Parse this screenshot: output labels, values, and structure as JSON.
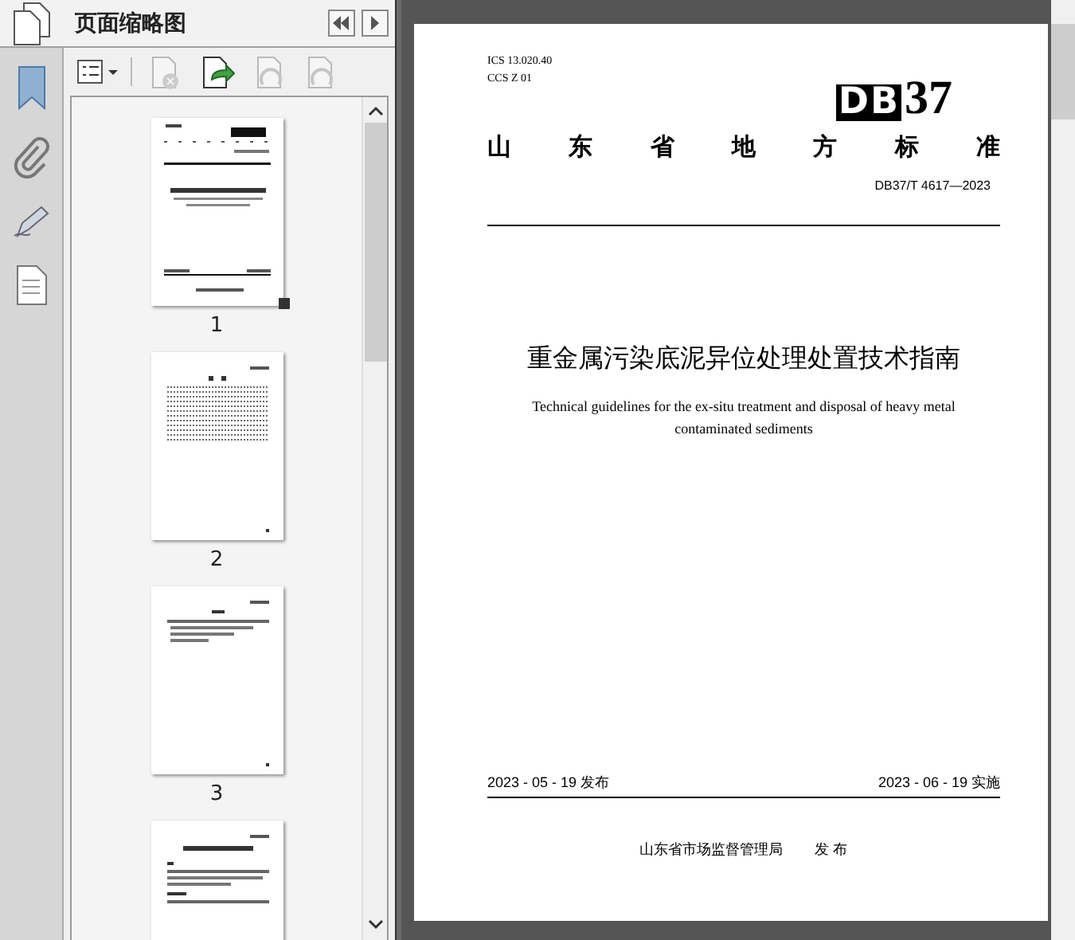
{
  "panel": {
    "title": "页面缩略图",
    "toolbar": [
      {
        "kind": "options",
        "disabled": false
      },
      {
        "kind": "delete",
        "disabled": true
      },
      {
        "kind": "insert",
        "disabled": false
      },
      {
        "kind": "rotate-left",
        "disabled": true
      },
      {
        "kind": "rotate-right",
        "disabled": true
      }
    ],
    "thumbnails": [
      {
        "kind": "cover",
        "page": "1",
        "selected": true
      },
      {
        "kind": "contents",
        "page": "2",
        "selected": false
      },
      {
        "kind": "text",
        "page": "3",
        "selected": false
      },
      {
        "kind": "heading"
      }
    ]
  },
  "document": {
    "ics": "ICS  13.020.40",
    "ccs": "CCS  Z 01",
    "logo_letters": "DB",
    "logo_number": "37",
    "category": "山 东 省 地 方 标 准",
    "code": "DB37/T 4617—2023",
    "title": "重金属污染底泥异位处理处置技术指南",
    "subtitle": "Technical guidelines for the ex-situ treatment and disposal of heavy metal contaminated sediments",
    "issued": "2023 - 05 - 19 发布",
    "effective": "2023 - 06 - 19 实施",
    "issuer": "山东省市场监督管理局",
    "issue_label": "发 布"
  }
}
